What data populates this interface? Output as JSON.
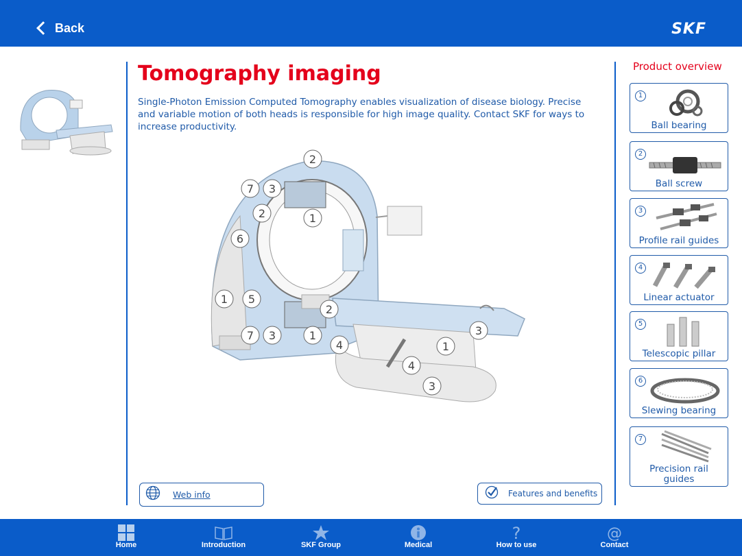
{
  "header": {
    "back_label": "Back",
    "logo_text": "SKF",
    "background_color": "#0a5cc9"
  },
  "main": {
    "title": "Tomography imaging",
    "title_color": "#e4001b",
    "description": "Single-Photon Emission Computed Tomography enables visualization of disease biology. Precise and variable motion of both heads is responsible for high image quality. Contact SKF for ways to increase productivity.",
    "callouts": [
      "2",
      "7",
      "3",
      "2",
      "1",
      "6",
      "1",
      "5",
      "2",
      "7",
      "3",
      "1",
      "4",
      "4",
      "3",
      "1",
      "3"
    ],
    "web_info_label": "Web info",
    "features_label": "Features and benefits"
  },
  "product_overview": {
    "title": "Product overview",
    "items": [
      {
        "num": "1",
        "name": "Ball bearing",
        "icon": "ball-bearing"
      },
      {
        "num": "2",
        "name": "Ball screw",
        "icon": "ball-screw"
      },
      {
        "num": "3",
        "name": "Profile rail guides",
        "icon": "profile-rail-guides"
      },
      {
        "num": "4",
        "name": "Linear actuator",
        "icon": "linear-actuator"
      },
      {
        "num": "5",
        "name": "Telescopic pillar",
        "icon": "telescopic-pillar"
      },
      {
        "num": "6",
        "name": "Slewing bearing",
        "icon": "slewing-bearing"
      },
      {
        "num": "7",
        "name": "Precision rail guides",
        "icon": "precision-rail-guides"
      }
    ]
  },
  "footer": {
    "items": [
      {
        "label": "Home",
        "icon": "grid-icon"
      },
      {
        "label": "Introduction",
        "icon": "book-icon"
      },
      {
        "label": "SKF Group",
        "icon": "star-icon"
      },
      {
        "label": "Medical",
        "icon": "info-icon"
      },
      {
        "label": "How to use",
        "icon": "question-icon"
      },
      {
        "label": "Contact",
        "icon": "at-icon"
      }
    ]
  }
}
